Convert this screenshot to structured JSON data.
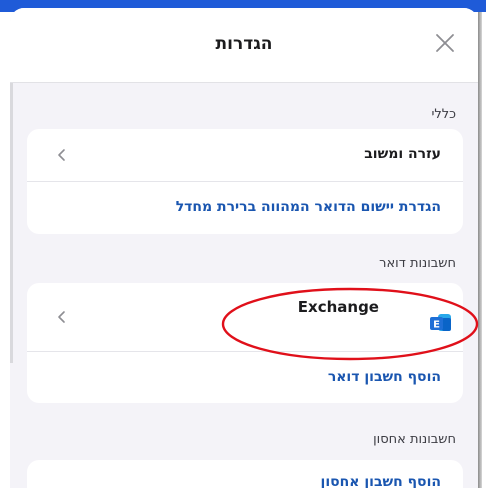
{
  "header": {
    "title": "הגדרות"
  },
  "general": {
    "label": "כללי",
    "help_item": "עזרה ומשוב",
    "default_app_link": "הגדרת יישום הדואר המהווה ברירת מחדל"
  },
  "mail_accounts": {
    "label": "חשבונות דואר",
    "account_name": "Exchange",
    "account_icon_letter": "E",
    "add_link": "הוסף חשבון דואר"
  },
  "storage_accounts": {
    "label": "חשבונות אחסון",
    "add_link": "הוסף חשבון אחסון"
  },
  "colors": {
    "accent": "#1a56b0",
    "highlight": "#e0101a",
    "exchange_blue": "#1f6fd6"
  }
}
